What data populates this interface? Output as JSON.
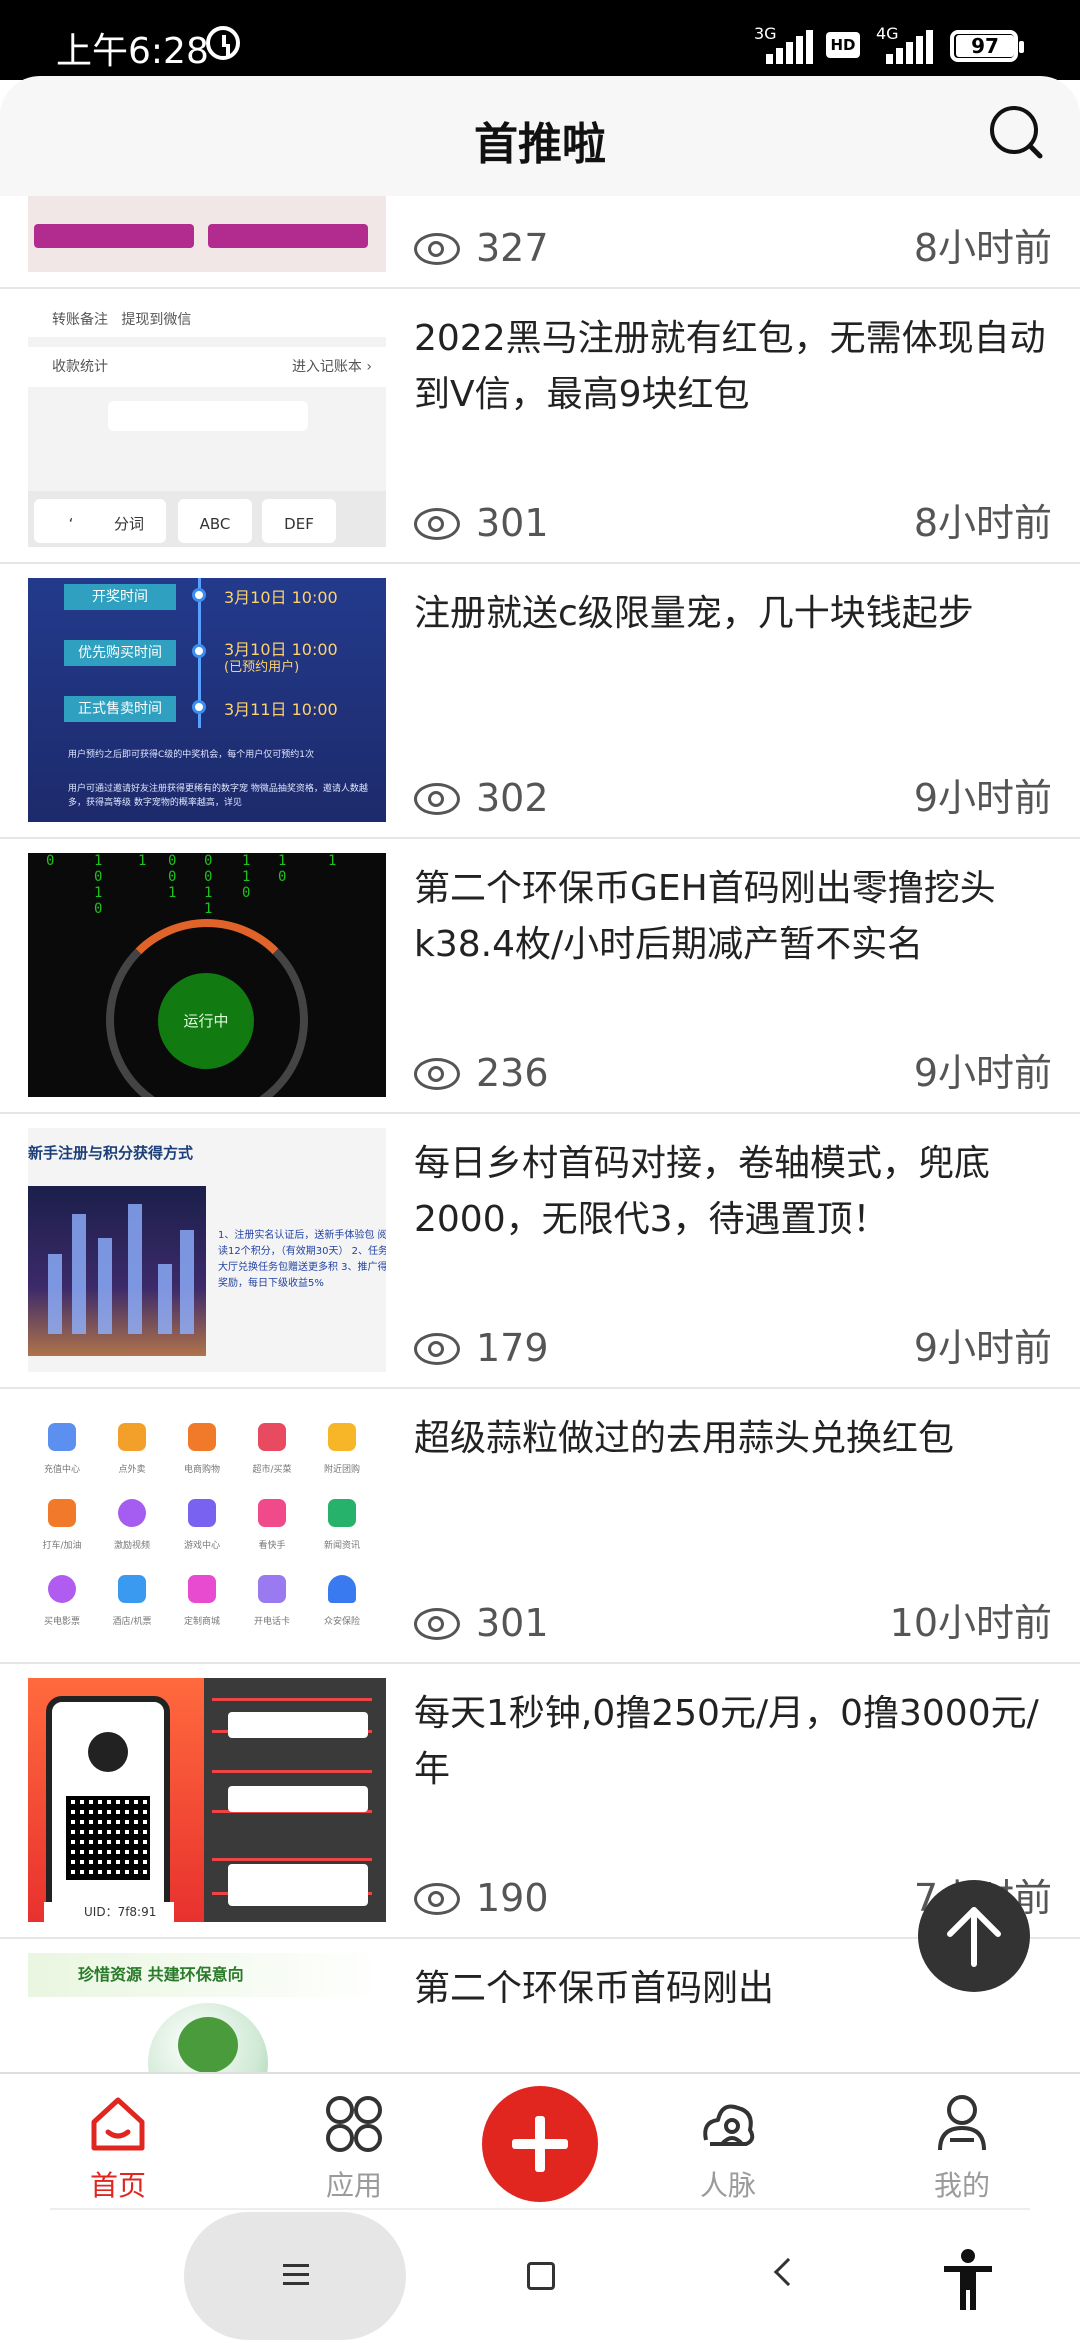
{
  "status_bar": {
    "time": "上午6:28",
    "network_1": "3G",
    "hd": "HD",
    "network_2": "4G",
    "battery": "97"
  },
  "header": {
    "title": "首推啦"
  },
  "feed": [
    {
      "title": "",
      "views": "327",
      "time": "8小时前"
    },
    {
      "title": "2022黑马注册就有红包，无需体现自动到V信，最高9块红包",
      "views": "301",
      "time": "8小时前"
    },
    {
      "title": "注册就送c级限量宠，几十块钱起步",
      "views": "302",
      "time": "9小时前"
    },
    {
      "title": "第二个环保币GEH首码刚出零撸挖头k38.4枚/小时后期减产暂不实名",
      "views": "236",
      "time": "9小时前"
    },
    {
      "title": "每日乡村首码对接，卷轴模式，兜底2000，无限代3，待遇置顶！",
      "views": "179",
      "time": "9小时前"
    },
    {
      "title": "超级蒜粒做过的去用蒜头兑换红包",
      "views": "301",
      "time": "10小时前"
    },
    {
      "title": "每天1秒钟,0撸250元/月，0撸3000元/年",
      "views": "190",
      "time": "7小时前"
    },
    {
      "title": "第二个环保币首码刚出",
      "views": "",
      "time": ""
    }
  ],
  "thumbs": {
    "chat": {
      "row1": "转账备注",
      "row1b": "提现到微信",
      "row2": "收款统计",
      "row2b": "进入记账本 ›",
      "keys": [
        "分词",
        "ABC",
        "DEF"
      ]
    },
    "blue": {
      "tags": [
        "开奖时间",
        "优先购买时间",
        "正式售卖时间"
      ],
      "dates": [
        "3月10日 10:00",
        "3月10日 10:00",
        "3月11日 10:00"
      ],
      "date_sub": "(已预约用户)",
      "note1": "用户预约之后即可获得C级的中奖机会，每个用户仅可预约1次",
      "note2": "用户可通过邀请好友注册获得更稀有的数字宠 物微品抽奖资格，邀请人数越多，获得高等级 数字宠物的概率越高，详见"
    },
    "dark": {
      "status": "运行中"
    },
    "city": {
      "caption": "新手注册与积分获得方式",
      "text": "1、注册实名认证后，送新手体验包 阅读12个积分，（有效期30天） 2、任务大厅兑换任务包赠送更多积 3、推广得奖励，每日下级收益5%"
    },
    "grid": [
      "充值中心",
      "点外卖",
      "电商购物",
      "超市/买菜",
      "附近团购",
      "打车/加油",
      "激励视频",
      "游戏中心",
      "看快手",
      "新闻资讯",
      "买电影票",
      "酒店/机票",
      "定制商城",
      "开电话卡",
      "众安保险"
    ],
    "red": {
      "uid": "UID：7f8:91"
    },
    "eco": {
      "banner": "珍惜资源 共建环保意向"
    }
  },
  "tabbar": {
    "tabs": [
      {
        "label": "首页",
        "icon": "home-icon",
        "active": true
      },
      {
        "label": "应用",
        "icon": "apps-icon",
        "active": false
      },
      {
        "label": "人脉",
        "icon": "contacts-icon",
        "active": false
      },
      {
        "label": "我的",
        "icon": "profile-icon",
        "active": false
      }
    ]
  },
  "colors": {
    "accent": "#e0261f",
    "inactive": "#9b9b9b"
  }
}
